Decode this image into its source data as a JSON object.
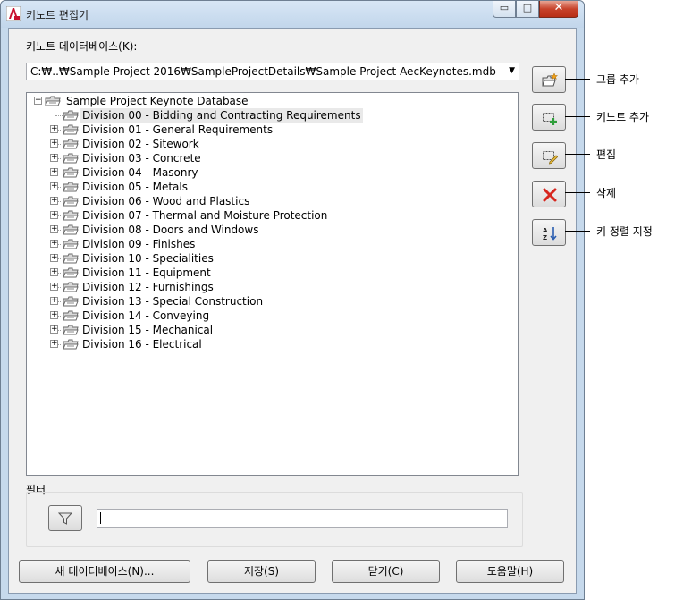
{
  "window": {
    "title": "키노트 편집기",
    "minimize_glyph": "▭",
    "maximize_glyph": "□",
    "close_glyph": "✕"
  },
  "database": {
    "label": "키노트 데이터베이스(K):",
    "path": "C:₩..₩Sample Project 2016₩SampleProjectDetails₩Sample Project AecKeynotes.mdb",
    "dropdown_glyph": "▼"
  },
  "tree": {
    "root": "Sample Project Keynote Database",
    "collapse_glyph": "−",
    "expand_glyph": "+",
    "items": [
      {
        "label": "Division 00 - Bidding and Contracting Requirements",
        "selected": true,
        "expandable": false
      },
      {
        "label": "Division 01 - General Requirements",
        "selected": false,
        "expandable": true
      },
      {
        "label": "Division 02 - Sitework",
        "selected": false,
        "expandable": true
      },
      {
        "label": "Division 03 - Concrete",
        "selected": false,
        "expandable": true
      },
      {
        "label": "Division 04 - Masonry",
        "selected": false,
        "expandable": true
      },
      {
        "label": "Division 05 - Metals",
        "selected": false,
        "expandable": true
      },
      {
        "label": "Division 06 - Wood and Plastics",
        "selected": false,
        "expandable": true
      },
      {
        "label": "Division 07 - Thermal and Moisture Protection",
        "selected": false,
        "expandable": true
      },
      {
        "label": "Division 08 - Doors and Windows",
        "selected": false,
        "expandable": true
      },
      {
        "label": "Division 09 - Finishes",
        "selected": false,
        "expandable": true
      },
      {
        "label": "Division 10 - Specialities",
        "selected": false,
        "expandable": true
      },
      {
        "label": "Division 11 - Equipment",
        "selected": false,
        "expandable": true
      },
      {
        "label": "Division 12 - Furnishings",
        "selected": false,
        "expandable": true
      },
      {
        "label": "Division 13 - Special Construction",
        "selected": false,
        "expandable": true
      },
      {
        "label": "Division 14 - Conveying",
        "selected": false,
        "expandable": true
      },
      {
        "label": "Division 15 - Mechanical",
        "selected": false,
        "expandable": true
      },
      {
        "label": "Division 16 - Electrical",
        "selected": false,
        "expandable": true
      }
    ]
  },
  "side_buttons": [
    {
      "icon": "add-group-icon",
      "callout": "그룹 추가"
    },
    {
      "icon": "add-keynote-icon",
      "callout": "키노트 추가"
    },
    {
      "icon": "edit-icon",
      "callout": "편집"
    },
    {
      "icon": "delete-icon",
      "callout": "삭제"
    },
    {
      "icon": "sort-key-icon",
      "callout": "키 정렬 지정"
    }
  ],
  "filter": {
    "label": "필터",
    "icon": "filter-icon",
    "value": ""
  },
  "bottom_buttons": {
    "new_database": "새 데이터베이스(N)...",
    "save": "저장(S)",
    "close": "닫기(C)",
    "help": "도움말(H)"
  },
  "colors": {
    "accent_red": "#d7261e",
    "green_plus": "#2e9e3a",
    "selection": "#e9e9e9"
  }
}
